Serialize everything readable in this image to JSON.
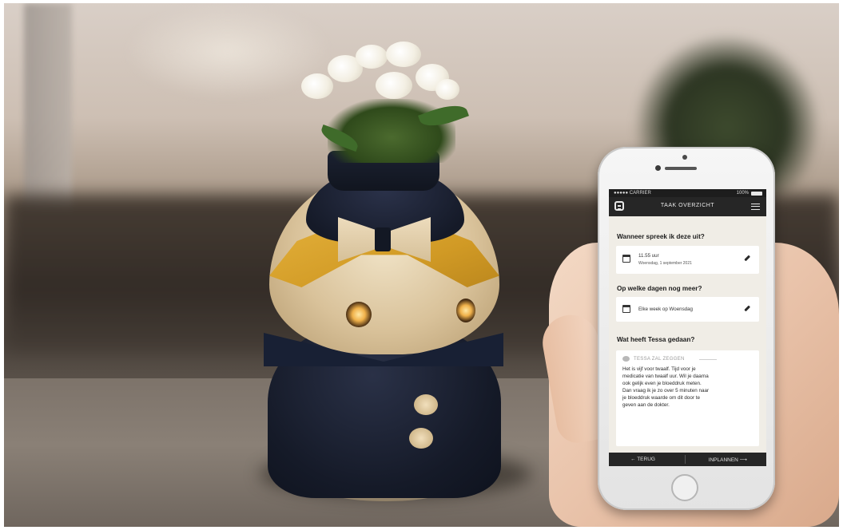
{
  "status_bar": {
    "carrier": "●●●●● CARRIER",
    "battery": "100%"
  },
  "app": {
    "title": "TAAK OVERZICHT",
    "logo_icon": "robot-face-icon",
    "menu_icon": "hamburger-menu-icon"
  },
  "questions": {
    "when": "Wanneer spreek ik deze uit?",
    "days": "Op welke dagen nog meer?",
    "done": "Wat heeft Tessa gedaan?"
  },
  "time_card": {
    "time": "11.55 uur",
    "date": "Woensdag, 1 september 2021",
    "icon": "calendar-icon",
    "edit_icon": "pencil-icon"
  },
  "days_card": {
    "text": "Elke week op Woensdag",
    "icon": "calendar-icon",
    "edit_icon": "pencil-icon"
  },
  "message_card": {
    "header": "TESSA ZAL ZEGGEN",
    "icon": "speech-bubble-icon",
    "body": "Het is vijf voor twaalf. Tijd voor je medicatie van twaalf uur. Wil je daarna ook gelijk even je bloeddruk meten. Dan vraag ik je zo over 5 minuten naar je bloeddruk waarde om dit door te geven aan de dokter."
  },
  "footer": {
    "back": "← TERUG",
    "schedule": "INPLANNEN ⟶"
  }
}
